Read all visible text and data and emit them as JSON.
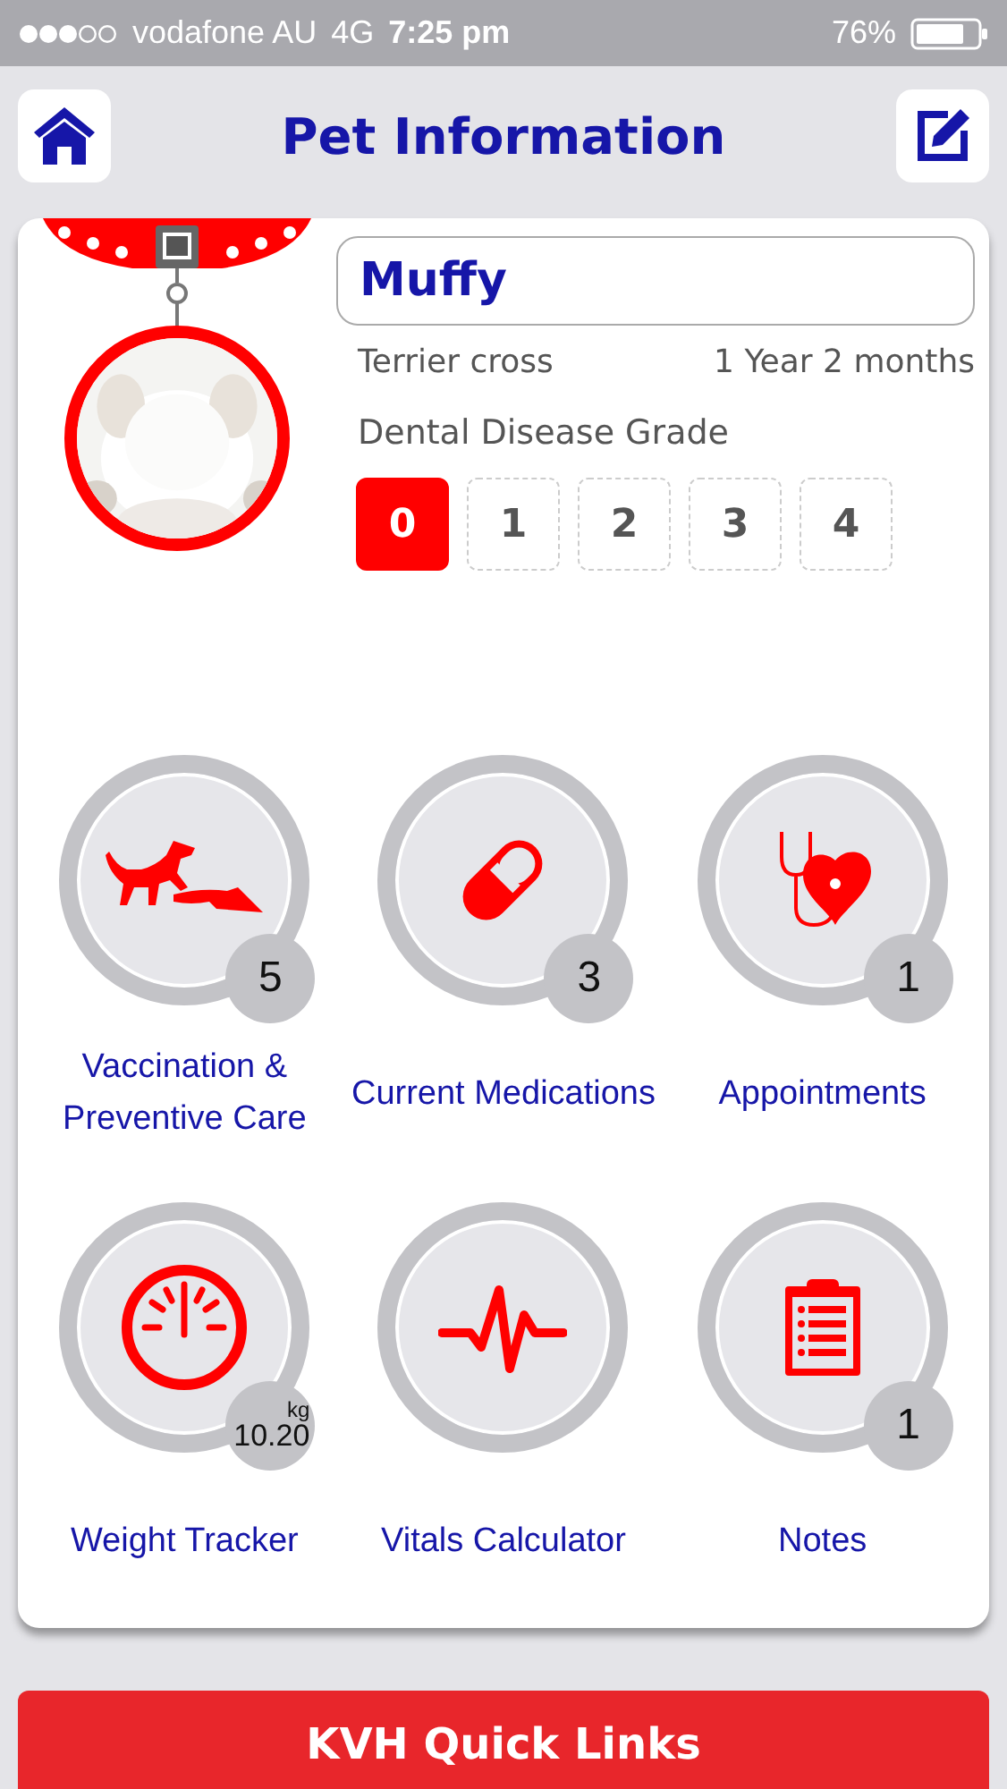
{
  "status_bar": {
    "carrier": "vodafone AU",
    "network": "4G",
    "time": "7:25 pm",
    "battery": "76%"
  },
  "header": {
    "title": "Pet Information"
  },
  "pet": {
    "name": "Muffy",
    "breed": "Terrier cross",
    "age": "1 Year 2 months"
  },
  "dental": {
    "label": "Dental Disease Grade",
    "grades": [
      {
        "label": "0",
        "selected": true
      },
      {
        "label": "1",
        "selected": false
      },
      {
        "label": "2",
        "selected": false
      },
      {
        "label": "3",
        "selected": false
      },
      {
        "label": "4",
        "selected": false
      }
    ]
  },
  "tiles": [
    {
      "kind": "vaccination",
      "label": "Vaccination & Preventive Care",
      "badge": {
        "kind": "count",
        "value": "5"
      }
    },
    {
      "kind": "medications",
      "label": "Current Medications",
      "badge": {
        "kind": "count",
        "value": "3"
      }
    },
    {
      "kind": "appointments",
      "label": "Appointments",
      "badge": {
        "kind": "count",
        "value": "1"
      }
    },
    {
      "kind": "weight",
      "label": "Weight Tracker",
      "badge": {
        "kind": "weight",
        "unit": "kg",
        "value": "10.20"
      }
    },
    {
      "kind": "vitals",
      "label": "Vitals Calculator"
    },
    {
      "kind": "notes",
      "label": "Notes",
      "badge": {
        "kind": "count",
        "value": "1"
      }
    }
  ],
  "footer_button": "KVH Quick Links"
}
